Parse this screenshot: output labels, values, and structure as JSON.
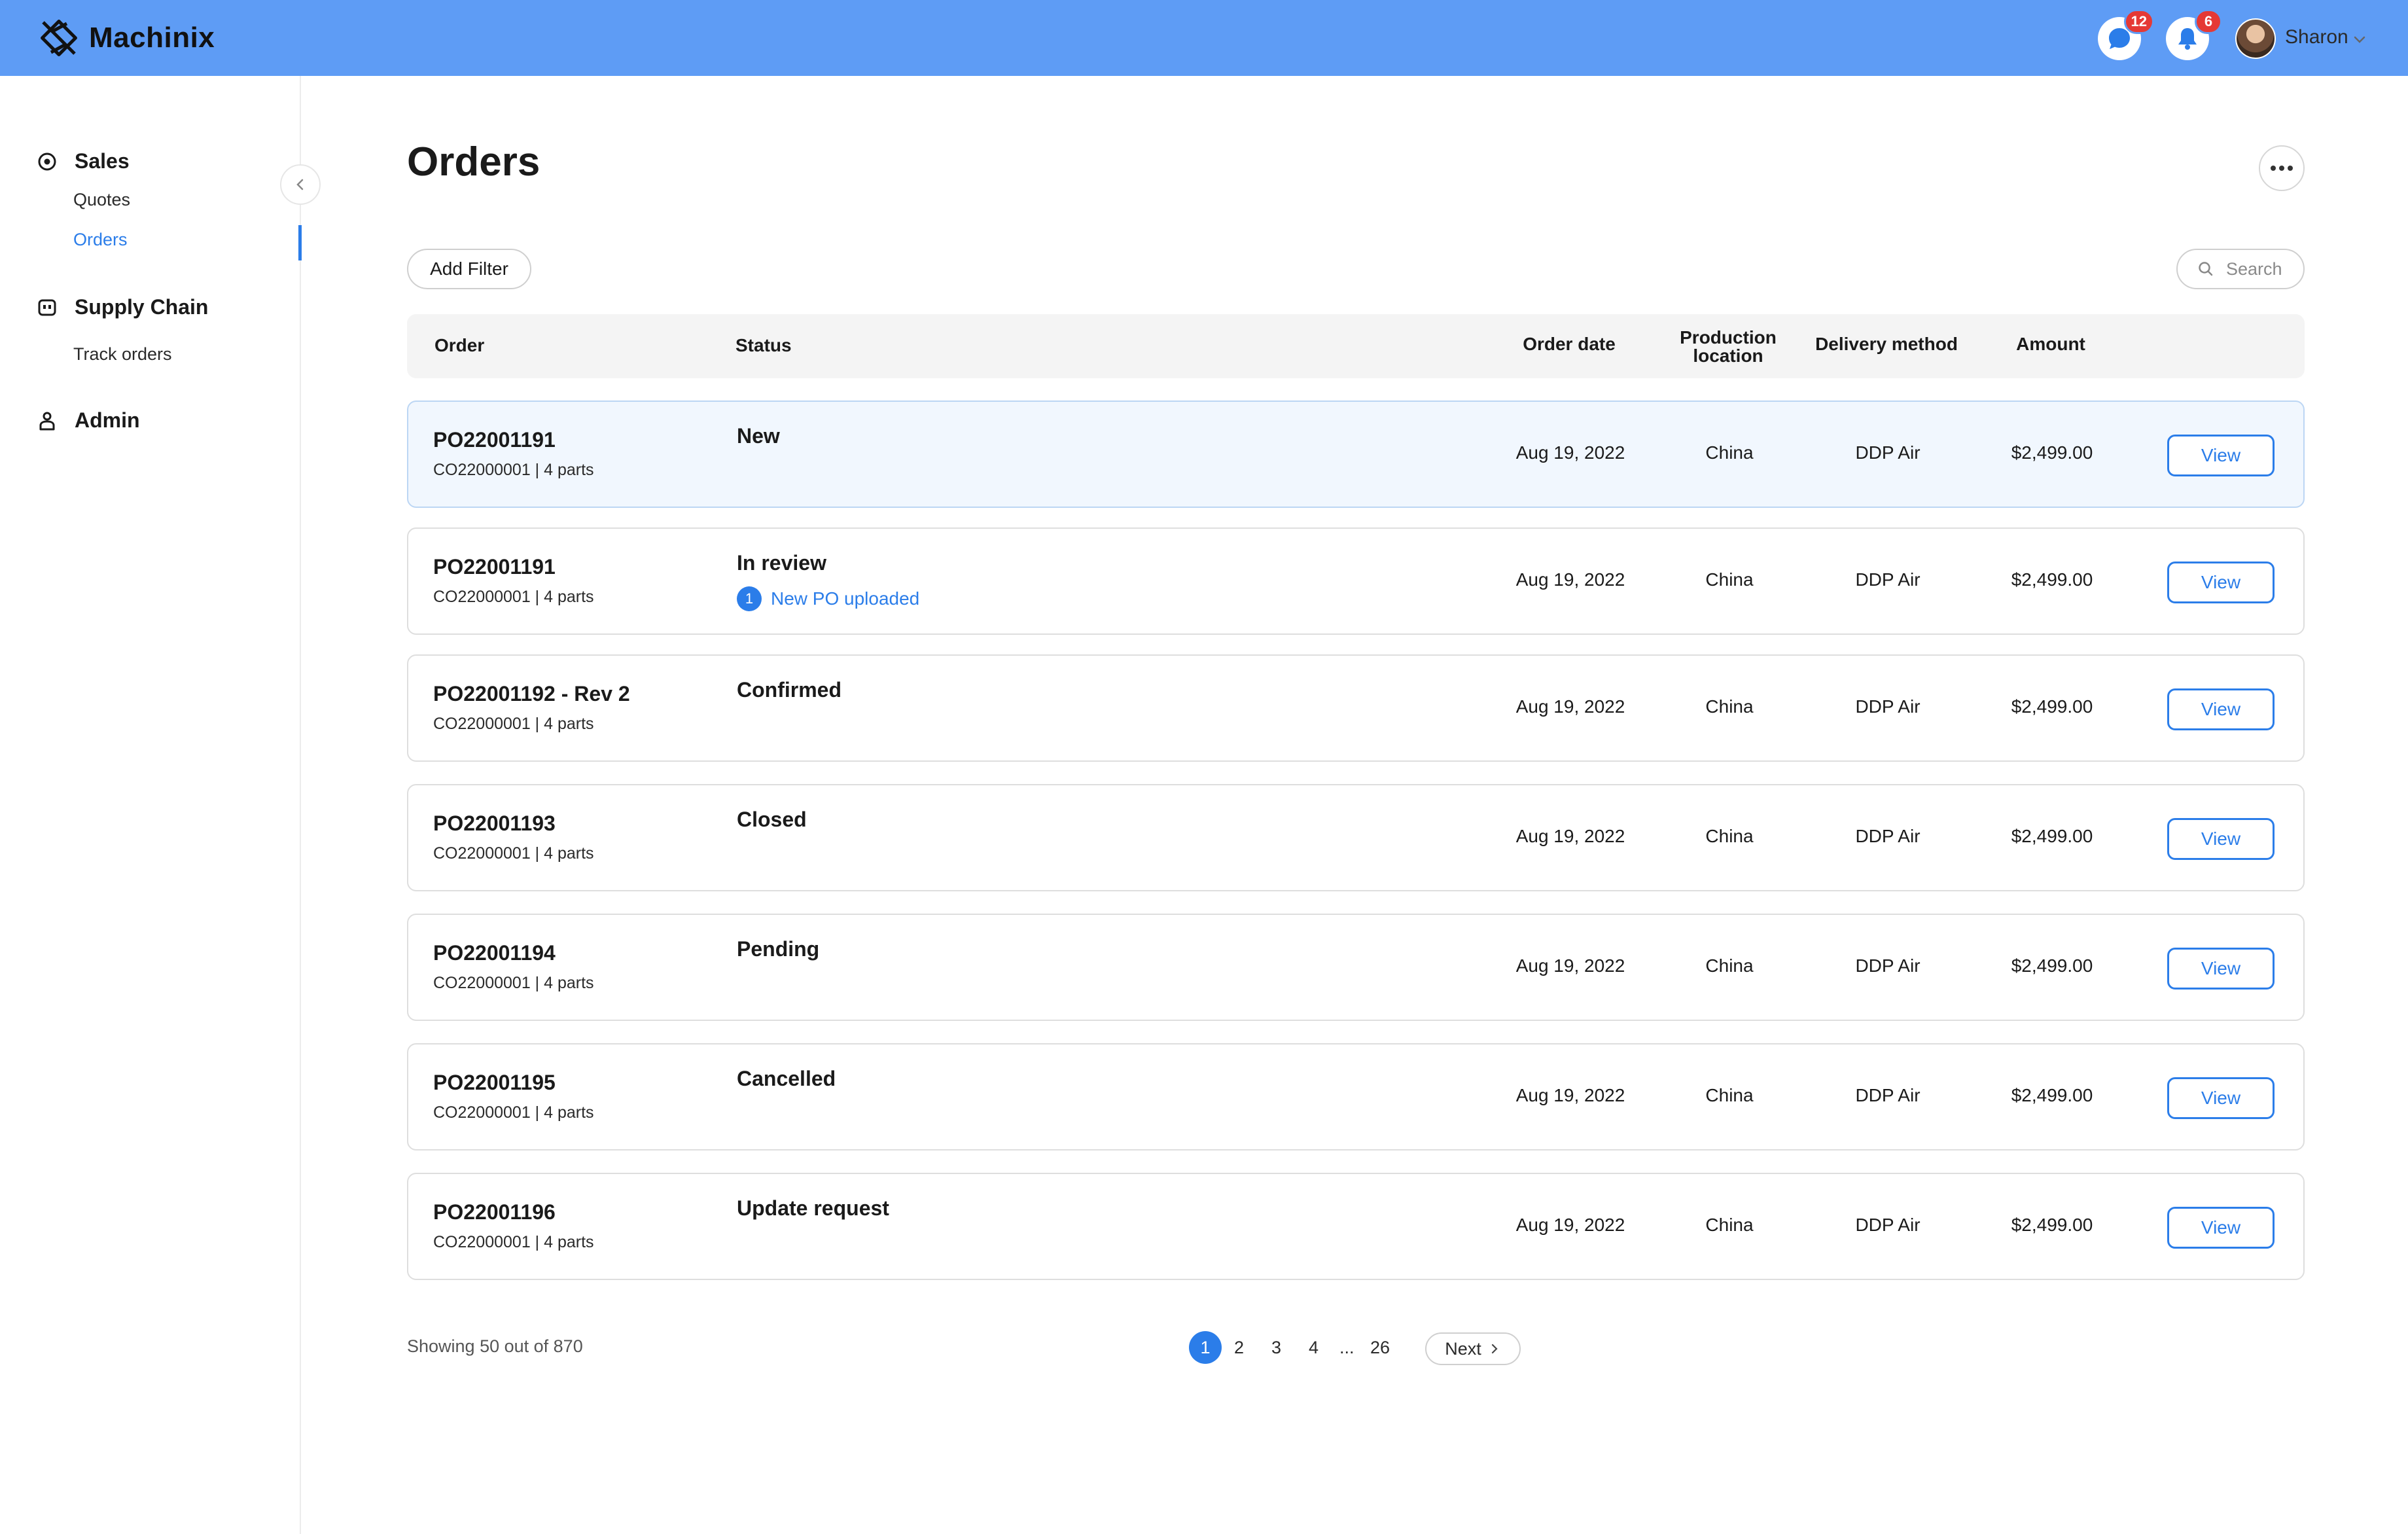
{
  "header": {
    "brand": "Machinix",
    "messages_badge": "12",
    "notifications_badge": "6",
    "user_name": "Sharon"
  },
  "sidebar": {
    "groups": [
      {
        "label": "Sales",
        "icon": "target-icon",
        "items": [
          {
            "label": "Quotes"
          },
          {
            "label": "Orders",
            "active": true
          }
        ]
      },
      {
        "label": "Supply Chain",
        "icon": "supply-chain-icon",
        "items": [
          {
            "label": "Track orders"
          }
        ]
      },
      {
        "label": "Admin",
        "icon": "user-icon",
        "items": []
      }
    ]
  },
  "main": {
    "title": "Orders",
    "add_filter_label": "Add Filter",
    "search_placeholder": "Search",
    "columns": {
      "order": "Order",
      "status": "Status",
      "order_date": "Order date",
      "production_location_line1": "Production",
      "production_location_line2": "location",
      "delivery_method": "Delivery method",
      "amount": "Amount"
    },
    "rows": [
      {
        "order": "PO22001191",
        "customer_order": "CO22000001 |",
        "parts": "4 parts",
        "status": "New",
        "date": "Aug 19, 2022",
        "location": "China",
        "delivery": "DDP Air",
        "amount": "$2,499.00",
        "action": "View",
        "highlighted": true
      },
      {
        "order": "PO22001191",
        "customer_order": "CO22000001 |",
        "parts": "4 parts",
        "status": "In review",
        "note_count": "1",
        "note": "New PO uploaded",
        "date": "Aug 19, 2022",
        "location": "China",
        "delivery": "DDP Air",
        "amount": "$2,499.00",
        "action": "View"
      },
      {
        "order": "PO22001192 - Rev 2",
        "customer_order": "CO22000001 |",
        "parts": "4 parts",
        "status": "Confirmed",
        "date": "Aug 19, 2022",
        "location": "China",
        "delivery": "DDP Air",
        "amount": "$2,499.00",
        "action": "View"
      },
      {
        "order": "PO22001193",
        "customer_order": "CO22000001 |",
        "parts": "4 parts",
        "status": "Closed",
        "date": "Aug 19, 2022",
        "location": "China",
        "delivery": "DDP Air",
        "amount": "$2,499.00",
        "action": "View"
      },
      {
        "order": "PO22001194",
        "customer_order": "CO22000001 |",
        "parts": "4 parts",
        "status": "Pending",
        "date": "Aug 19, 2022",
        "location": "China",
        "delivery": "DDP Air",
        "amount": "$2,499.00",
        "action": "View"
      },
      {
        "order": "PO22001195",
        "customer_order": "CO22000001 |",
        "parts": "4 parts",
        "status": "Cancelled",
        "date": "Aug 19, 2022",
        "location": "China",
        "delivery": "DDP Air",
        "amount": "$2,499.00",
        "action": "View"
      },
      {
        "order": "PO22001196",
        "customer_order": "CO22000001 |",
        "parts": "4 parts",
        "status": "Update request",
        "date": "Aug 19, 2022",
        "location": "China",
        "delivery": "DDP Air",
        "amount": "$2,499.00",
        "action": "View"
      }
    ]
  },
  "pagination": {
    "showing": "Showing 50 out of 870",
    "pages": [
      "1",
      "2",
      "3",
      "4",
      "...",
      "26"
    ],
    "current": "1",
    "next_label": "Next"
  },
  "colors": {
    "topbar": "#5e9cf5",
    "accent": "#2b7de9",
    "badge": "#e53935",
    "row_highlight": "#f1f7fe"
  }
}
